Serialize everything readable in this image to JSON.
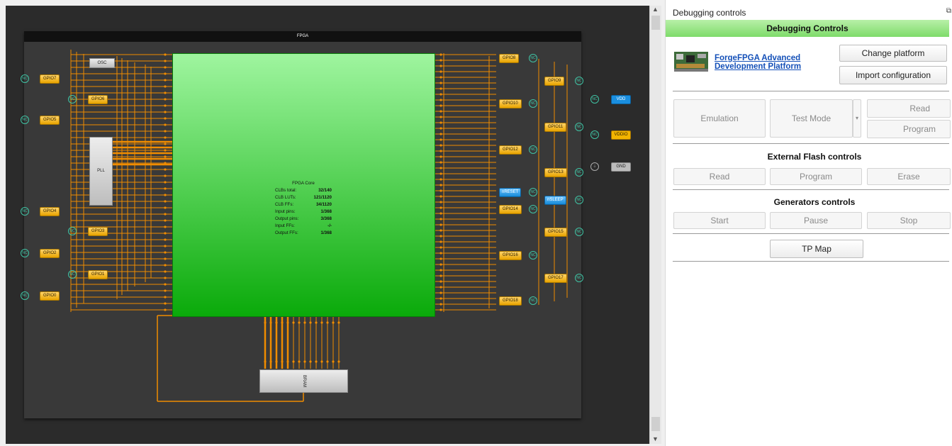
{
  "fpga": {
    "header": "FPGA",
    "core": {
      "title": "FPGA Core",
      "rows": [
        {
          "label": "CLBs total:",
          "value": "32/140"
        },
        {
          "label": "CLB LUTs:",
          "value": "121/1120"
        },
        {
          "label": "CLB FFs:",
          "value": "34/1120"
        },
        {
          "label": "Input pins:",
          "value": "1/368"
        },
        {
          "label": "Output pins:",
          "value": "3/368"
        },
        {
          "label": "Input FFs:",
          "value": "-/-"
        },
        {
          "label": "Output FFs:",
          "value": "1/368"
        }
      ]
    },
    "blocks": {
      "osc": "OSC",
      "pll": "PLL",
      "bram": "BRAM"
    },
    "gpio_left": [
      "GPIO7",
      "GPIO6",
      "GPIO5",
      "GPIO4",
      "GPIO3",
      "GPIO2",
      "GPIO1",
      "GPIO0"
    ],
    "gpio_right": [
      "GPIO8",
      "GPIO9",
      "GPIO10",
      "GPIO11",
      "GPIO12",
      "GPIO13",
      "nRESET",
      "nSLEEP",
      "GPIO14",
      "GPIO15",
      "GPIO16",
      "GPIO17",
      "GPIO18"
    ],
    "nc_label": "NC",
    "power": {
      "vdd": "VDD",
      "vddio": "VDDIO",
      "gnd": "GND"
    },
    "colors": {
      "wire": "#f08c00",
      "core": "#2ec42e",
      "gpio": "#f2b400",
      "nc": "#3fc3a4",
      "blue_pin": "#1a8fe0"
    }
  },
  "panel": {
    "title": "Debugging controls",
    "header": "Debugging Controls",
    "platform_link": [
      "ForgeFPGA Advanced",
      "Development Platform"
    ],
    "change_platform": "Change platform",
    "import_config": "Import configuration",
    "emulation": "Emulation",
    "test_mode": "Test Mode",
    "read": "Read",
    "program": "Program",
    "ext_flash_title": "External Flash controls",
    "flash_read": "Read",
    "flash_program": "Program",
    "flash_erase": "Erase",
    "gen_title": "Generators controls",
    "gen_start": "Start",
    "gen_pause": "Pause",
    "gen_stop": "Stop",
    "tp_map": "TP Map"
  }
}
